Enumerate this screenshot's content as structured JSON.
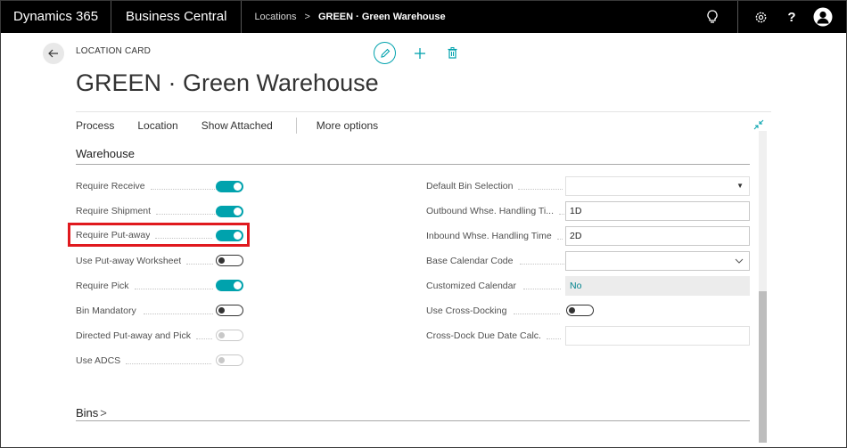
{
  "topbar": {
    "app_name": "Dynamics 365",
    "product": "Business Central",
    "breadcrumb": [
      "Locations",
      "GREEN · Green Warehouse"
    ],
    "breadcrumb_sep": ">",
    "icons": [
      "lightbulb-icon",
      "gear-icon",
      "help-icon",
      "user-avatar-icon"
    ],
    "help_label": "?"
  },
  "header": {
    "caption": "LOCATION CARD",
    "title": "GREEN · Green Warehouse",
    "actions": [
      "edit-icon",
      "new-icon",
      "delete-icon"
    ]
  },
  "actionbar": {
    "items": [
      "Process",
      "Location",
      "Show Attached"
    ],
    "more": "More options"
  },
  "warehouse": {
    "title": "Warehouse",
    "left": [
      {
        "label": "Require Receive",
        "state": "on"
      },
      {
        "label": "Require Shipment",
        "state": "on"
      },
      {
        "label": "Require Put-away",
        "state": "on"
      },
      {
        "label": "Use Put-away Worksheet",
        "state": "off"
      },
      {
        "label": "Require Pick",
        "state": "on"
      },
      {
        "label": "Bin Mandatory",
        "state": "off"
      },
      {
        "label": "Directed Put-away and Pick",
        "state": "disabled"
      },
      {
        "label": "Use ADCS",
        "state": "disabled"
      }
    ],
    "right": [
      {
        "label": "Default Bin Selection",
        "value": "",
        "kind": "select-disabled"
      },
      {
        "label": "Outbound Whse. Handling Ti...",
        "value": "1D",
        "kind": "text"
      },
      {
        "label": "Inbound Whse. Handling Time",
        "value": "2D",
        "kind": "text"
      },
      {
        "label": "Base Calendar Code",
        "value": "",
        "kind": "dropdown"
      },
      {
        "label": "Customized Calendar",
        "value": "No",
        "kind": "readonly"
      },
      {
        "label": "Use Cross-Docking",
        "value": "off",
        "kind": "toggle"
      },
      {
        "label": "Cross-Dock Due Date Calc.",
        "value": "",
        "kind": "text-disabled"
      }
    ]
  },
  "bins": {
    "title": "Bins",
    "chevron": ">"
  },
  "colors": {
    "accent": "#00a2ad",
    "highlight": "#e0191e",
    "topbar": "#000000"
  }
}
